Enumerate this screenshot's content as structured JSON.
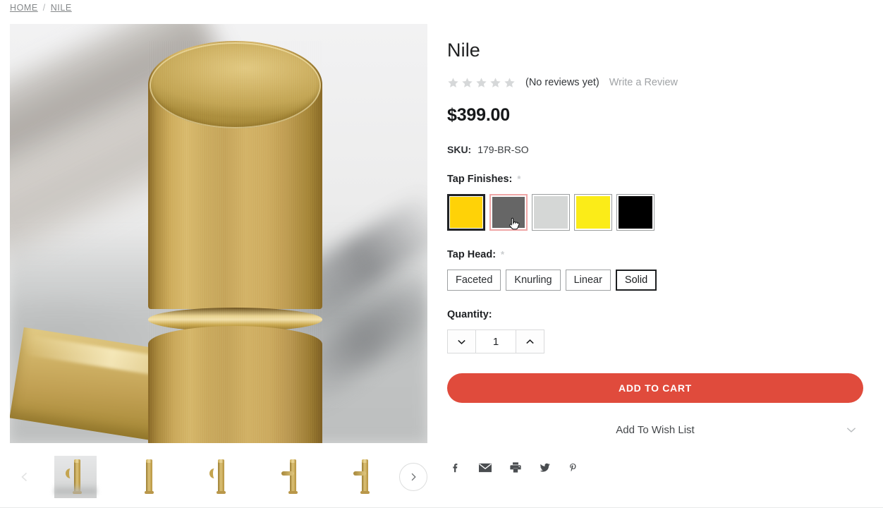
{
  "breadcrumb": {
    "items": [
      {
        "label": "HOME"
      },
      {
        "label": "NILE"
      }
    ],
    "separator": "/"
  },
  "gallery": {
    "main_image_alt": "Nile brushed brass tap close-up",
    "prev_label": "Previous",
    "next_label": "Next",
    "thumbnails": [
      {
        "alt": "Nile tap full view on counter",
        "active": true
      },
      {
        "alt": "Nile tap straight body view",
        "active": false
      },
      {
        "alt": "Nile tap angled spout view",
        "active": false
      },
      {
        "alt": "Nile tap curved spout view",
        "active": false
      },
      {
        "alt": "Nile tap side profile view",
        "active": false
      }
    ]
  },
  "product": {
    "title": "Nile",
    "rating": {
      "stars": 0,
      "star_count": 5,
      "star_color": "#d6d8d9",
      "reviews_text": "(No reviews yet)",
      "write_review_label": "Write a Review"
    },
    "price": "$399.00",
    "sku_label": "SKU:",
    "sku_value": "179-BR-SO"
  },
  "options": {
    "tap_finishes": {
      "label": "Tap Finishes:",
      "required_marker": "*",
      "swatches": [
        {
          "name": "gold",
          "color": "#FFD207",
          "selected": true,
          "hovered": false
        },
        {
          "name": "gunmetal",
          "color": "#666666",
          "selected": false,
          "hovered": true
        },
        {
          "name": "light-grey",
          "color": "#D5D7D6",
          "selected": false,
          "hovered": false
        },
        {
          "name": "yellow",
          "color": "#FBEC18",
          "selected": false,
          "hovered": false
        },
        {
          "name": "black",
          "color": "#000000",
          "selected": false,
          "hovered": false
        }
      ]
    },
    "tap_head": {
      "label": "Tap Head:",
      "required_marker": "*",
      "choices": [
        {
          "label": "Faceted",
          "selected": false
        },
        {
          "label": "Knurling",
          "selected": false
        },
        {
          "label": "Linear",
          "selected": false
        },
        {
          "label": "Solid",
          "selected": true
        }
      ]
    },
    "quantity": {
      "label": "Quantity:",
      "value": "1",
      "decrement_icon": "chevron-down-icon",
      "increment_icon": "chevron-up-icon"
    }
  },
  "actions": {
    "add_to_cart_label": "ADD TO CART",
    "add_to_cart_color": "#e04b3c",
    "wishlist_label": "Add To Wish List",
    "wishlist_chevron": "chevron-down-icon"
  },
  "share": {
    "items": [
      {
        "icon": "facebook-icon",
        "label": "Facebook"
      },
      {
        "icon": "email-icon",
        "label": "Email"
      },
      {
        "icon": "print-icon",
        "label": "Print"
      },
      {
        "icon": "twitter-icon",
        "label": "Twitter"
      },
      {
        "icon": "pinterest-icon",
        "label": "Pinterest"
      }
    ]
  }
}
